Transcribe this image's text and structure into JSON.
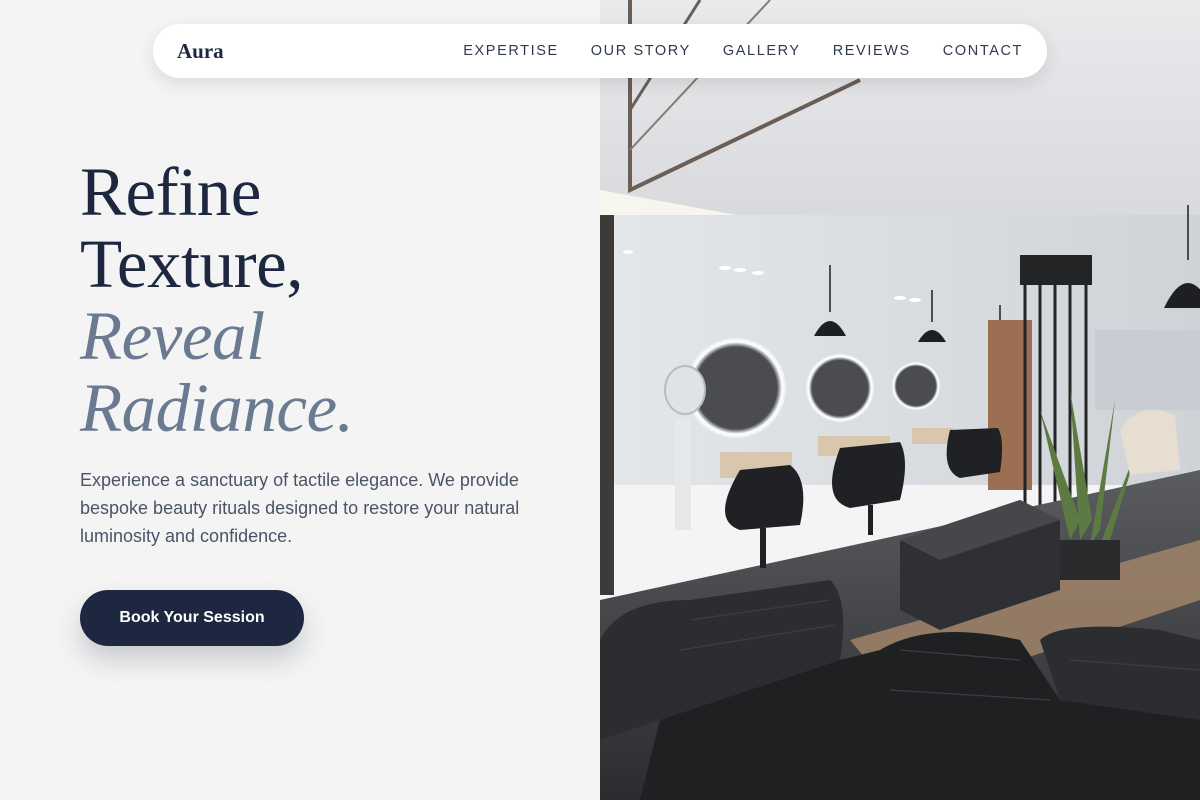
{
  "brand": {
    "name": "Aura"
  },
  "nav": {
    "items": [
      {
        "label": "EXPERTISE"
      },
      {
        "label": "OUR STORY"
      },
      {
        "label": "GALLERY"
      },
      {
        "label": "REVIEWS"
      },
      {
        "label": "CONTACT"
      }
    ]
  },
  "hero": {
    "headline": {
      "line1": "Refine",
      "line2": "Texture,",
      "line3": "Reveal",
      "line4": "Radiance."
    },
    "description": "Experience a sanctuary of tactile elegance. We provide bespoke beauty rituals designed to restore your natural luminosity and confidence.",
    "cta_label": "Book Your Session"
  },
  "colors": {
    "primary": "#1d2840",
    "accent": "#6a7a90",
    "background": "#f4f4f4"
  }
}
